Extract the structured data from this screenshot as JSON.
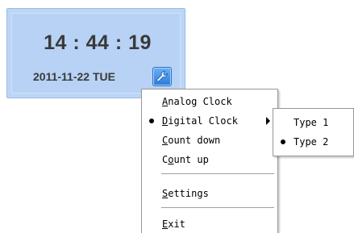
{
  "clock": {
    "time": "14 : 44 : 19",
    "date": "2011-11-22 TUE",
    "settings_icon": "wrench-icon"
  },
  "context_menu": {
    "items": [
      {
        "prefix": "",
        "key": "A",
        "suffix": "nalog Clock",
        "checked": false,
        "submenu": false
      },
      {
        "prefix": "",
        "key": "D",
        "suffix": "igital Clock",
        "checked": true,
        "submenu": true
      },
      {
        "prefix": "",
        "key": "C",
        "suffix": "ount down",
        "checked": false,
        "submenu": false
      },
      {
        "prefix": "C",
        "key": "o",
        "suffix": "unt up",
        "checked": false,
        "submenu": false
      },
      {
        "prefix": "",
        "key": "S",
        "suffix": "ettings",
        "checked": false,
        "submenu": false
      },
      {
        "prefix": "",
        "key": "E",
        "suffix": "xit",
        "checked": false,
        "submenu": false
      }
    ]
  },
  "submenu": {
    "items": [
      {
        "label": "Type 1",
        "checked": false
      },
      {
        "label": "Type 2",
        "checked": true
      }
    ]
  },
  "colors": {
    "widget_background": "#b7d2f4",
    "widget_border": "#9db9df",
    "button_accent": "#2a7ad9",
    "menu_border": "#979797"
  }
}
